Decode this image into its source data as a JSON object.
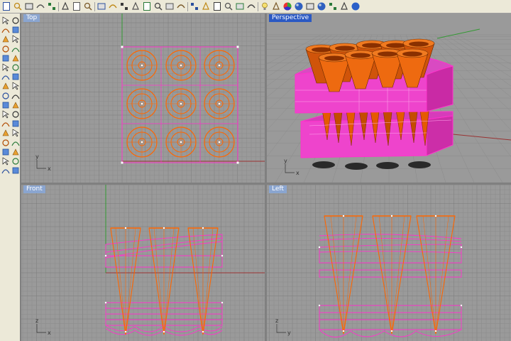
{
  "toolbar": {
    "buttons": [
      "new-icon",
      "open-icon",
      "save-icon",
      "print-icon",
      "import-icon",
      "cut-icon",
      "copy-icon",
      "paste-icon",
      "undo-icon",
      "pan-icon",
      "rotate-view-icon",
      "zoom-icon",
      "zoom-window-icon",
      "zoom-selected-icon",
      "zoom-extents-icon",
      "zoom-all-icon",
      "four-views-icon",
      "camera-icon",
      "car-icon",
      "grid-snap-icon",
      "lock-icon",
      "points-icon",
      "lightbulb-icon",
      "gear-icon",
      "color-wheel-icon",
      "render-shaded-icon",
      "render-preview-icon",
      "sphere-icon",
      "material-icon",
      "options-icon",
      "help-icon"
    ]
  },
  "sidebar": {
    "tools": [
      "select-arrow-icon",
      "point-icon",
      "polyline-icon",
      "line-icon",
      "circle-icon",
      "curve-icon",
      "arc-icon",
      "rectangle-icon",
      "ellipse-icon",
      "polygon-icon",
      "freeform-curve-icon",
      "fillet-icon",
      "surface-icon",
      "extrude-icon",
      "solid-box-icon",
      "sphere-solid-icon",
      "cylinder-icon",
      "cone-icon",
      "mesh-icon",
      "boolean-icon",
      "trim-icon",
      "split-icon",
      "join-icon",
      "explode-icon",
      "transform-icon",
      "move-icon",
      "array-icon",
      "scale-icon",
      "analyze-icon",
      "dimension-icon",
      "render-icon",
      "layer-icon",
      "properties-icon",
      "text-icon"
    ]
  },
  "viewports": {
    "top": {
      "title": "Top",
      "active": false,
      "axis_x": "x",
      "axis_y": "y"
    },
    "perspective": {
      "title": "Perspective",
      "active": true,
      "axis_x": "x",
      "axis_y": "y",
      "axis_z": "z"
    },
    "front": {
      "title": "Front",
      "active": false,
      "axis_x": "x",
      "axis_z": "z"
    },
    "left": {
      "title": "Left",
      "active": false,
      "axis_y": "y",
      "axis_z": "z"
    }
  },
  "colors": {
    "viewport_bg": "#9a9a9a",
    "grid": "#8b8b8b",
    "grid_major": "#7b7b7b",
    "selected": "#ff33cc",
    "cone": "#ff6600",
    "x_axis": "#993333",
    "y_axis": "#339933"
  }
}
